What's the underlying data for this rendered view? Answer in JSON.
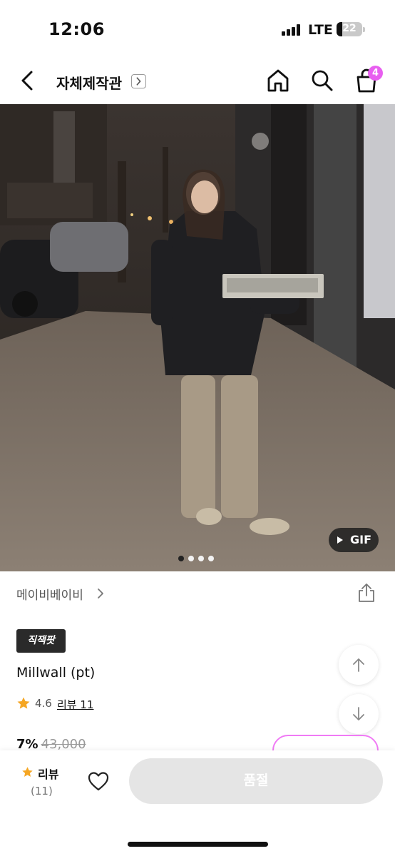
{
  "status_bar": {
    "time": "12:06",
    "network": "LTE",
    "battery": "22",
    "battery_level_percent": 22
  },
  "nav": {
    "title": "자체제작관",
    "cart_count": "4",
    "icons": [
      "back-icon",
      "chevron-right-icon",
      "home-icon",
      "search-icon",
      "cart-icon"
    ]
  },
  "hero": {
    "gif_label": "GIF",
    "dots_total": 4,
    "dots_active_index": 0
  },
  "store": {
    "name": "메이비베이비"
  },
  "product": {
    "tag": "직잭팟",
    "name": "Millwall (pt)",
    "rating": "4.6",
    "review_link": "리뷰 11",
    "discount": "7%",
    "original_price": "43,000"
  },
  "bottom_bar": {
    "review_label": "리뷰",
    "review_count": "(11)",
    "soldout_label": "품절"
  },
  "colors": {
    "accent_pink": "#e85ff0",
    "star": "#f5a623",
    "soldout_bg": "#e5e5e5",
    "tag_bg": "#2a2a2a"
  }
}
